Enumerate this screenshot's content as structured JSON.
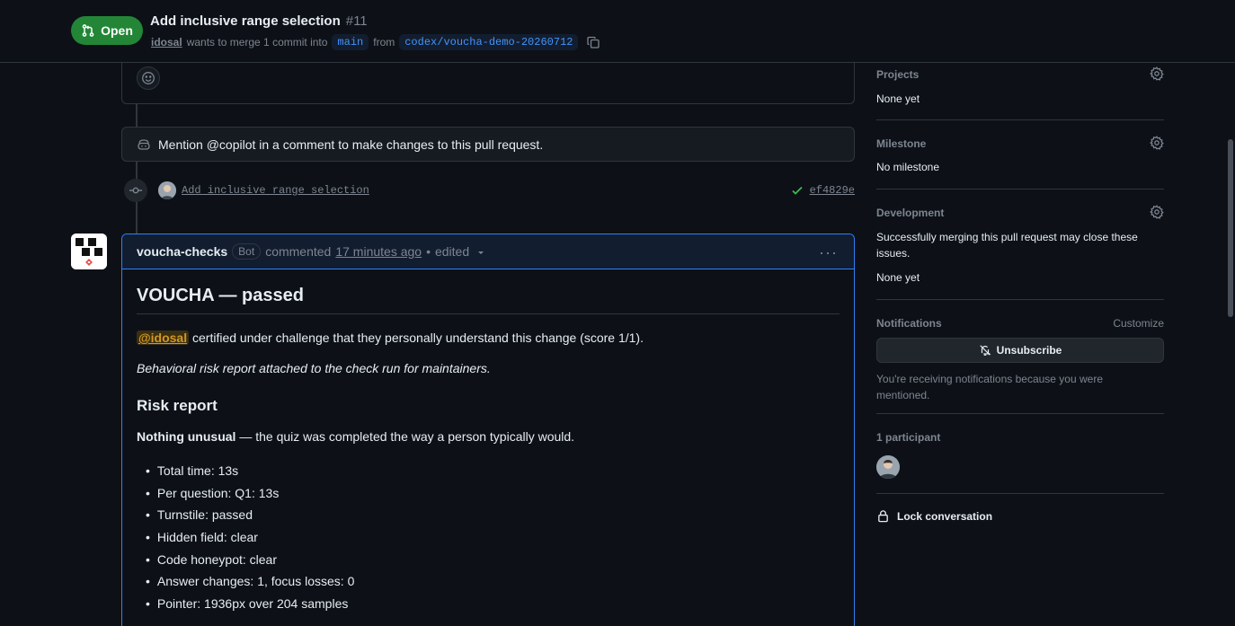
{
  "header": {
    "state": "Open",
    "title": "Add inclusive range selection",
    "number": "#11",
    "author": "idosal",
    "merge_text": "wants to merge 1 commit into",
    "base_branch": "main",
    "from_text": "from",
    "head_branch": "codex/voucha-demo-20260712"
  },
  "timeline": {
    "copilot_hint": "Mention @copilot in a comment to make changes to this pull request.",
    "commit_message": "Add inclusive range selection",
    "commit_sha": "ef4829e"
  },
  "comment": {
    "author": "voucha-checks",
    "badge": "Bot",
    "action": "commented",
    "time": "17 minutes ago",
    "separator": "•",
    "edited": "edited",
    "title": "VOUCHA — passed",
    "mention": "@idosal",
    "certify_text": "certified under challenge that they personally understand this change (score 1/1).",
    "italic_note": "Behavioral risk report attached to the check run for maintainers.",
    "risk_heading": "Risk report",
    "summary_bold": "Nothing unusual",
    "summary_rest": "— the quiz was completed the way a person typically would.",
    "items": [
      "Total time: 13s",
      "Per question: Q1: 13s",
      "Turnstile: passed",
      "Hidden field: clear",
      "Code honeypot: clear",
      "Answer changes: 1, focus losses: 0",
      "Pointer: 1936px over 204 samples"
    ]
  },
  "sidebar": {
    "projects": {
      "heading": "Projects",
      "value": "None yet"
    },
    "milestone": {
      "heading": "Milestone",
      "value": "No milestone"
    },
    "development": {
      "heading": "Development",
      "note": "Successfully merging this pull request may close these issues.",
      "value": "None yet"
    },
    "notifications": {
      "heading": "Notifications",
      "customize": "Customize",
      "button": "Unsubscribe",
      "reason": "You're receiving notifications because you were mentioned."
    },
    "participants": {
      "heading": "1 participant"
    },
    "lock": "Lock conversation"
  },
  "colors": {
    "background": "#0d1117",
    "open_green": "#238636",
    "accent_blue": "#2f81f7",
    "mention_yellow": "#d29922"
  }
}
